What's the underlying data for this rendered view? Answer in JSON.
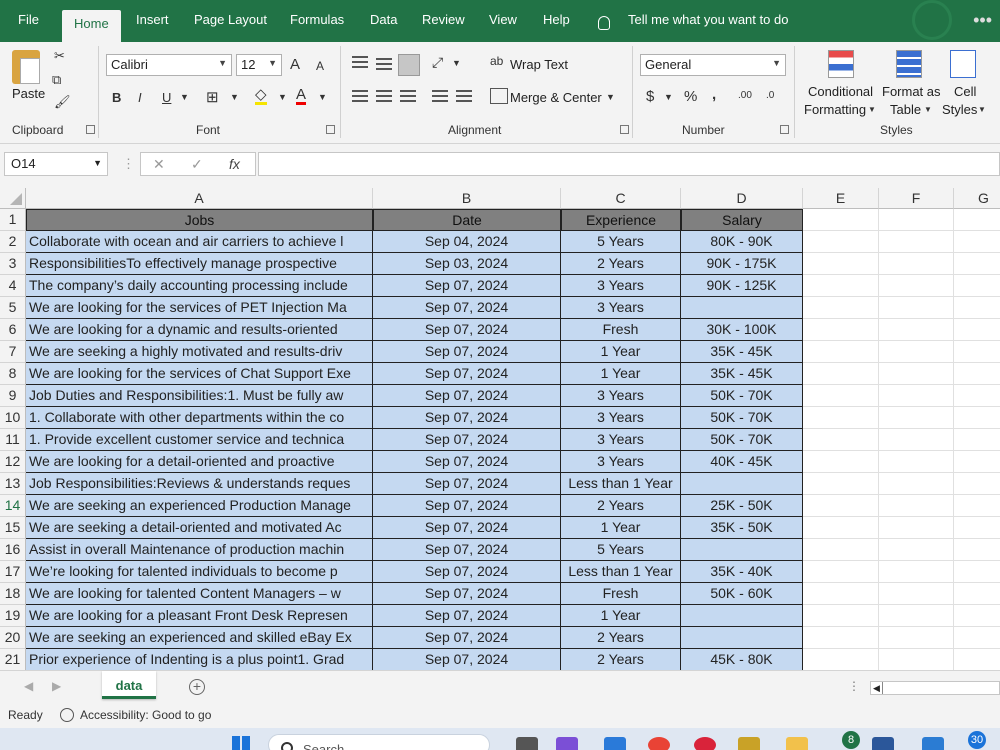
{
  "menu": {
    "tabs": [
      "File",
      "Home",
      "Insert",
      "Page Layout",
      "Formulas",
      "Data",
      "Review",
      "View",
      "Help"
    ],
    "active_tab": "Home",
    "tell_me": "Tell me what you want to do"
  },
  "ribbon": {
    "clipboard": {
      "paste": "Paste",
      "label": "Clipboard"
    },
    "font": {
      "name": "Calibri",
      "size": "12",
      "bold": "B",
      "italic": "I",
      "underline": "U",
      "grow": "A",
      "shrink": "A",
      "label": "Font"
    },
    "alignment": {
      "wrap_text": "Wrap Text",
      "merge_center": "Merge & Center",
      "label": "Alignment"
    },
    "number": {
      "format": "General",
      "currency": "$",
      "percent": "%",
      "comma": ",",
      "inc_decimal": ".00",
      "dec_decimal": ".0",
      "label": "Number"
    },
    "styles": {
      "conditional_formatting_1": "Conditional",
      "conditional_formatting_2": "Formatting",
      "format_as_table_1": "Format as",
      "format_as_table_2": "Table",
      "cell_styles_1": "Cell",
      "cell_styles_2": "Styles",
      "label": "Styles"
    }
  },
  "formula_bar": {
    "name_box": "O14",
    "cancel": "✕",
    "enter": "✓",
    "fx": "fx",
    "value": ""
  },
  "grid": {
    "columns": [
      "A",
      "B",
      "C",
      "D",
      "E",
      "F",
      "G"
    ],
    "selected_row": 14,
    "headers": [
      "Jobs",
      "Date",
      "Experience",
      "Salary"
    ],
    "rows": [
      {
        "num": "2",
        "jobs": "Collaborate with ocean and air carriers to achieve l",
        "date": "Sep 04, 2024",
        "experience": "5 Years",
        "salary": "80K - 90K"
      },
      {
        "num": "3",
        "jobs": "ResponsibilitiesTo effectively manage prospective",
        "date": "Sep 03, 2024",
        "experience": "2 Years",
        "salary": "90K - 175K"
      },
      {
        "num": "4",
        "jobs": "The company’s daily accounting processing include",
        "date": "Sep 07, 2024",
        "experience": "3 Years",
        "salary": "90K - 125K"
      },
      {
        "num": "5",
        "jobs": "We are looking for the services of PET Injection Ma",
        "date": "Sep 07, 2024",
        "experience": "3 Years",
        "salary": ""
      },
      {
        "num": "6",
        "jobs": "We are looking for a dynamic and results-oriented",
        "date": "Sep 07, 2024",
        "experience": "Fresh",
        "salary": "30K - 100K"
      },
      {
        "num": "7",
        "jobs": "We are seeking a highly motivated and results-driv",
        "date": "Sep 07, 2024",
        "experience": "1 Year",
        "salary": "35K - 45K"
      },
      {
        "num": "8",
        "jobs": "We are looking for the services of Chat Support Exe",
        "date": "Sep 07, 2024",
        "experience": "1 Year",
        "salary": "35K - 45K"
      },
      {
        "num": "9",
        "jobs": "Job Duties and Responsibilities:1. Must be fully aw",
        "date": "Sep 07, 2024",
        "experience": "3 Years",
        "salary": "50K - 70K"
      },
      {
        "num": "10",
        "jobs": "1. Collaborate with other departments within the co",
        "date": "Sep 07, 2024",
        "experience": "3 Years",
        "salary": "50K - 70K"
      },
      {
        "num": "11",
        "jobs": "1. Provide excellent customer service and technica",
        "date": "Sep 07, 2024",
        "experience": "3 Years",
        "salary": "50K - 70K"
      },
      {
        "num": "12",
        "jobs": "We are looking for a detail-oriented and proactive",
        "date": "Sep 07, 2024",
        "experience": "3 Years",
        "salary": "40K - 45K"
      },
      {
        "num": "13",
        "jobs": "Job Responsibilities:Reviews & understands reques",
        "date": "Sep 07, 2024",
        "experience": "Less than 1 Year",
        "salary": ""
      },
      {
        "num": "14",
        "jobs": "We are seeking an experienced Production Manage",
        "date": "Sep 07, 2024",
        "experience": "2 Years",
        "salary": "25K - 50K"
      },
      {
        "num": "15",
        "jobs": "We are seeking a detail-oriented and motivated Ac",
        "date": "Sep 07, 2024",
        "experience": "1 Year",
        "salary": "35K - 50K"
      },
      {
        "num": "16",
        "jobs": "Assist in overall Maintenance of production machin",
        "date": "Sep 07, 2024",
        "experience": "5 Years",
        "salary": ""
      },
      {
        "num": "17",
        "jobs": "We’re looking for talented individuals to become p",
        "date": "Sep 07, 2024",
        "experience": "Less than 1 Year",
        "salary": "35K - 40K"
      },
      {
        "num": "18",
        "jobs": "We are looking for talented Content Managers – w",
        "date": "Sep 07, 2024",
        "experience": "Fresh",
        "salary": "50K - 60K"
      },
      {
        "num": "19",
        "jobs": "We are looking for a pleasant Front Desk Represen",
        "date": "Sep 07, 2024",
        "experience": "1 Year",
        "salary": ""
      },
      {
        "num": "20",
        "jobs": "We are seeking an experienced and skilled eBay Ex",
        "date": "Sep 07, 2024",
        "experience": "2 Years",
        "salary": ""
      },
      {
        "num": "21",
        "jobs": "Prior experience of Indenting is a plus point1. Grad",
        "date": "Sep 07, 2024",
        "experience": "2 Years",
        "salary": "45K - 80K"
      }
    ]
  },
  "sheets": {
    "active": "data",
    "add": "+"
  },
  "status": {
    "ready": "Ready",
    "accessibility": "Accessibility: Good to go"
  },
  "taskbar": {
    "search": "Search",
    "badge_1": "8",
    "badge_2": "30"
  },
  "colors": {
    "excel_green": "#217346",
    "header_fill": "#808080",
    "data_fill": "#c5d9f1"
  }
}
